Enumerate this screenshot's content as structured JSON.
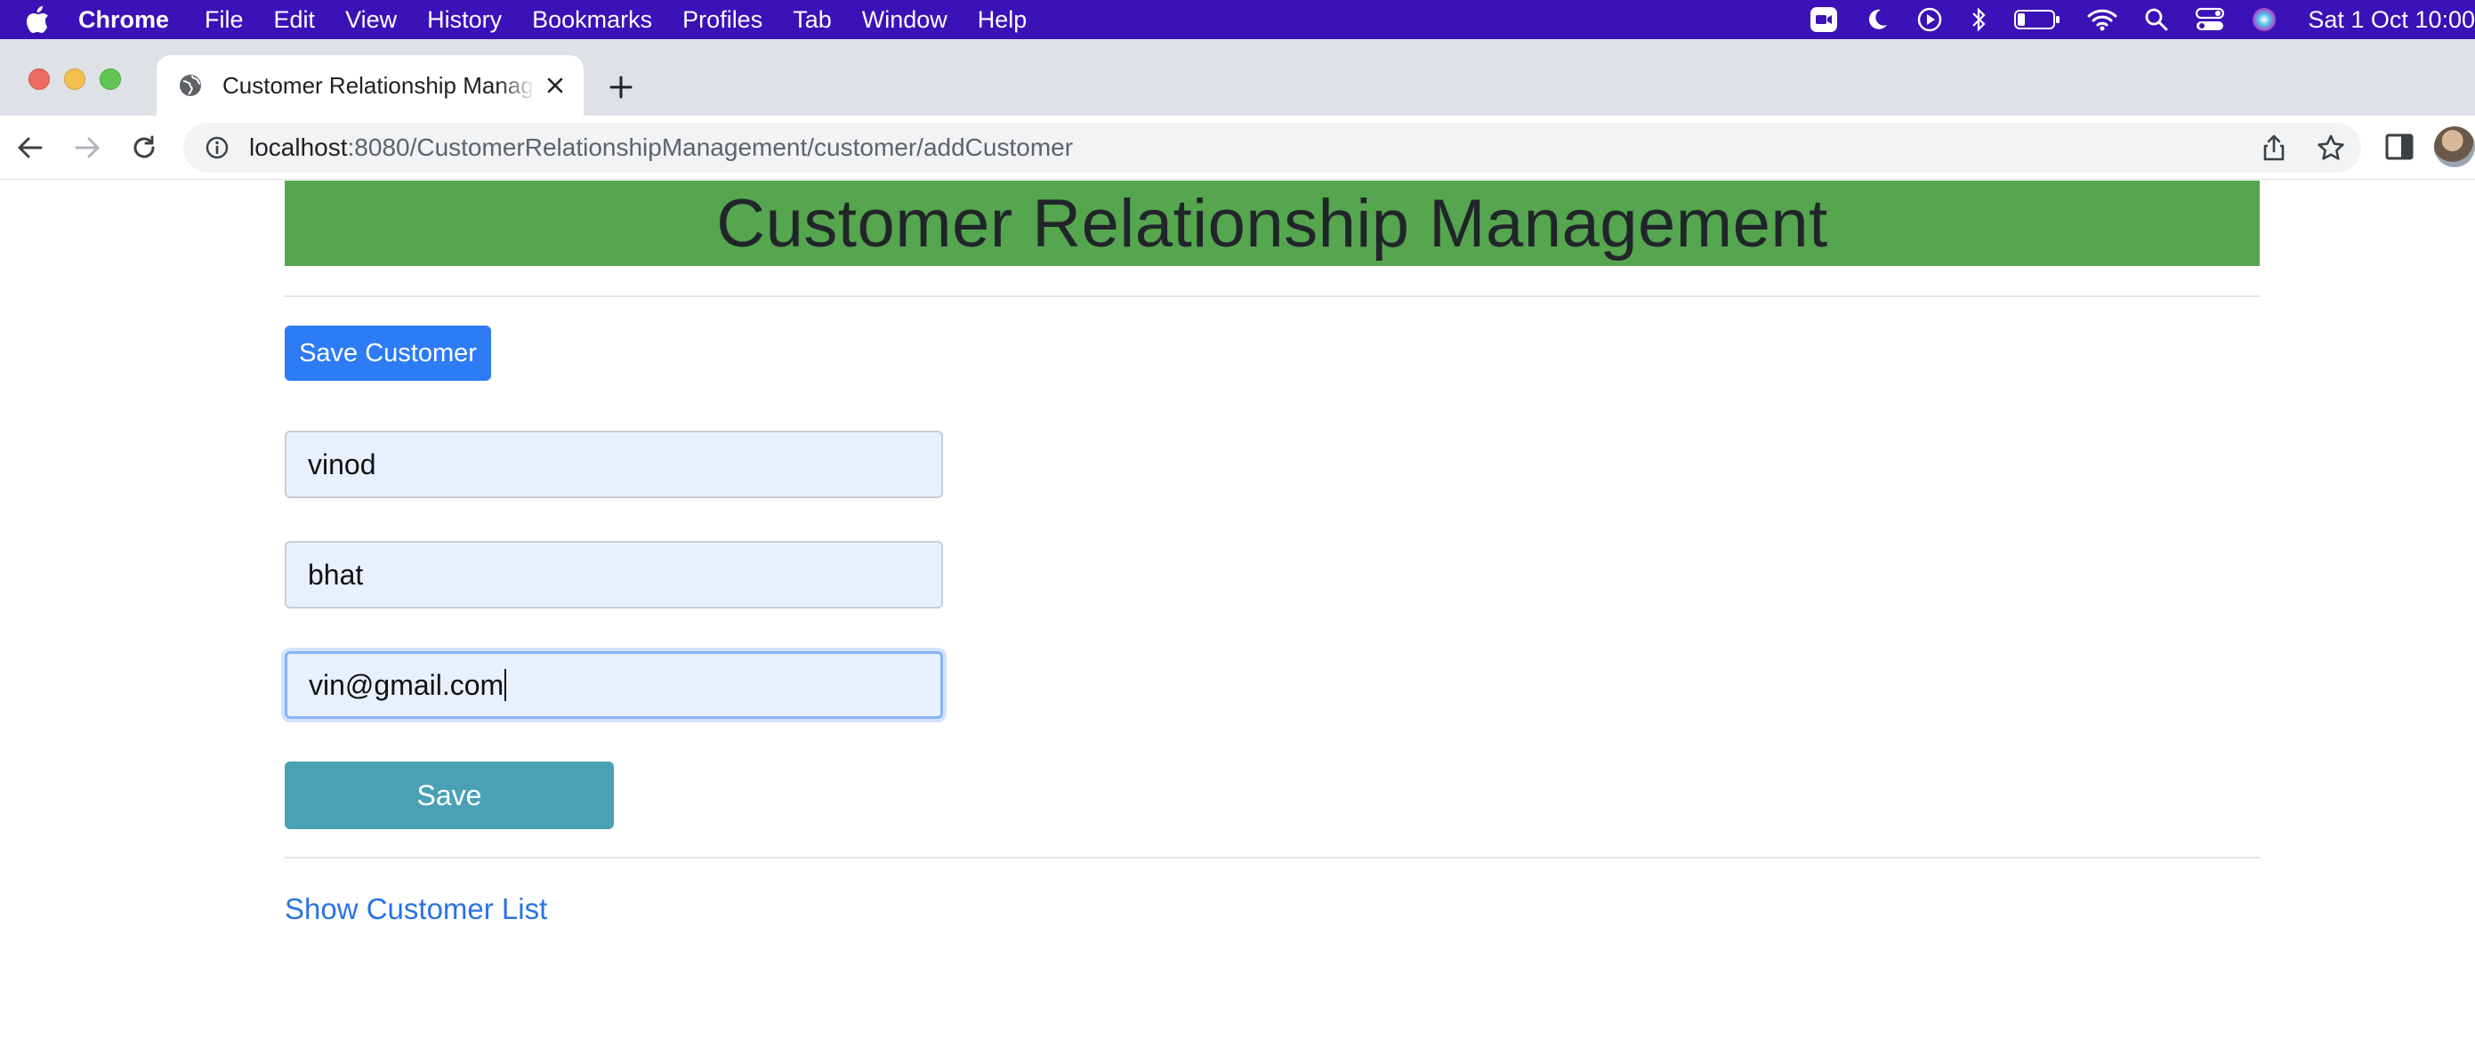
{
  "menubar": {
    "app_name": "Chrome",
    "items": [
      "File",
      "Edit",
      "View",
      "History",
      "Bookmarks",
      "Profiles",
      "Tab",
      "Window",
      "Help"
    ],
    "clock": "Sat 1 Oct  10:00"
  },
  "browser": {
    "tab_title": "Customer Relationship Management",
    "url_host": "localhost",
    "url_rest": ":8080/CustomerRelationshipManagement/customer/addCustomer"
  },
  "page": {
    "heading": "Customer Relationship Management",
    "save_customer_label": "Save Customer",
    "fields": {
      "first_name": "vinod",
      "last_name": "bhat",
      "email": "vin@gmail.com"
    },
    "save_label": "Save",
    "show_list_link": "Show Customer List"
  },
  "colors": {
    "menubar": "#3a12b8",
    "header_banner": "#55a64f",
    "primary_button": "#2e7bf6",
    "save_button": "#4aa0b4",
    "link": "#2a72e6"
  }
}
